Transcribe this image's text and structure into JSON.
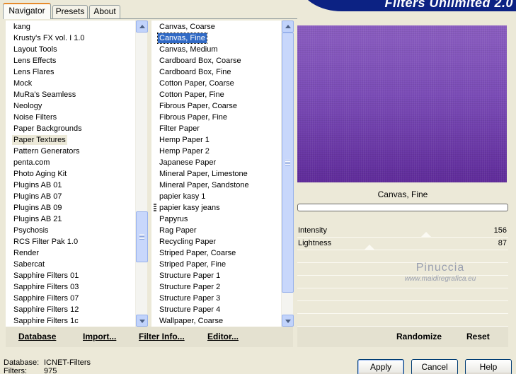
{
  "tabs": [
    {
      "label": "Navigator",
      "active": true
    },
    {
      "label": "Presets",
      "active": false
    },
    {
      "label": "About",
      "active": false
    }
  ],
  "banner": {
    "title": "Filters Unlimited 2.0",
    "color": "#0c2283"
  },
  "categories": {
    "items": [
      "kang",
      "Krusty's FX vol. I 1.0",
      "Layout Tools",
      "Lens Effects",
      "Lens Flares",
      "Mock",
      "MuRa's Seamless",
      "Neology",
      "Noise Filters",
      "Paper Backgrounds",
      "Paper Textures",
      "Pattern Generators",
      "penta.com",
      "Photo Aging Kit",
      "Plugins AB 01",
      "Plugins AB 07",
      "Plugins AB 09",
      "Plugins AB 21",
      "Psychosis",
      "RCS Filter Pak 1.0",
      "Render",
      "Sabercat",
      "Sapphire Filters 01",
      "Sapphire Filters 03",
      "Sapphire Filters 07",
      "Sapphire Filters 12",
      "Sapphire Filters 1c"
    ],
    "selected": "Paper Textures"
  },
  "filters": {
    "items": [
      "Canvas, Coarse",
      "Canvas, Fine",
      "Canvas, Medium",
      "Cardboard Box, Coarse",
      "Cardboard Box, Fine",
      "Cotton Paper, Coarse",
      "Cotton Paper, Fine",
      "Fibrous Paper, Coarse",
      "Fibrous Paper, Fine",
      "Filter Paper",
      "Hemp Paper 1",
      "Hemp Paper 2",
      "Japanese Paper",
      "Mineral Paper, Limestone",
      "Mineral Paper, Sandstone",
      "papier kasy 1",
      "papier kasy jeans",
      "Papyrus",
      "Rag Paper",
      "Recycling Paper",
      "Striped Paper, Coarse",
      "Striped Paper, Fine",
      "Structure Paper 1",
      "Structure Paper 2",
      "Structure Paper 3",
      "Structure Paper 4",
      "Wallpaper, Coarse"
    ],
    "selected": "Canvas, Fine"
  },
  "toolbar": {
    "database": "Database",
    "import": "Import...",
    "filter_info": "Filter Info...",
    "editor": "Editor...",
    "randomize": "Randomize",
    "reset": "Reset"
  },
  "preview": {
    "filter_name": "Canvas, Fine",
    "color_top": "#8a5dc0",
    "color_bottom": "#5f2b9a"
  },
  "parameters": [
    {
      "label": "Intensity",
      "value": "156",
      "fraction": 0.612
    },
    {
      "label": "Lightness",
      "value": "87",
      "fraction": 0.341
    }
  ],
  "watermark": {
    "line1": "Pinuccia",
    "line2": "www.maidiregrafica.eu"
  },
  "footer": {
    "database_label": "Database:",
    "database_value": "ICNET-Filters",
    "filters_label": "Filters:",
    "filters_value": "975",
    "apply": "Apply",
    "cancel": "Cancel",
    "help": "Help"
  }
}
